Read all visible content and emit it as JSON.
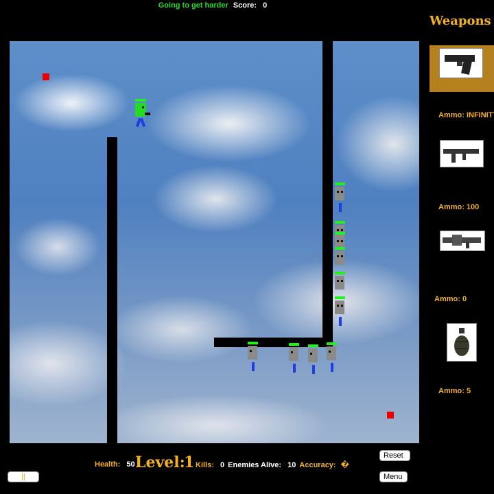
{
  "top": {
    "message": "Going to get harder",
    "score_label": "Score:",
    "score": "0"
  },
  "sidebar": {
    "title": "Weapons",
    "weapons": [
      {
        "icon": "pistol-icon",
        "ammo_label": "Ammo: INFINITY",
        "selected": true
      },
      {
        "icon": "smg-icon",
        "ammo_label": "Ammo: 100",
        "selected": false
      },
      {
        "icon": "launcher-icon",
        "ammo_label": "Ammo: 0",
        "selected": false
      },
      {
        "icon": "grenade-icon",
        "ammo_label": "Ammo: 5",
        "selected": false
      }
    ]
  },
  "hud": {
    "health_label": "Health:",
    "health": "50",
    "level_label": "Level:",
    "level": "1",
    "kills_label": "Kills:",
    "kills": "0",
    "enemies_alive_label": "Enemies Alive:",
    "enemies_alive": "10",
    "accuracy_label": "Accuracy:",
    "accuracy": "�"
  },
  "buttons": {
    "reset": "Reset",
    "menu": "Menu",
    "pause": "||"
  },
  "colors": {
    "accent": "#f5b21f",
    "message": "#22dd22",
    "selected_weapon_bg": "#b5801e",
    "health_bar": "#22ee22",
    "pickup": "#ee0000"
  }
}
